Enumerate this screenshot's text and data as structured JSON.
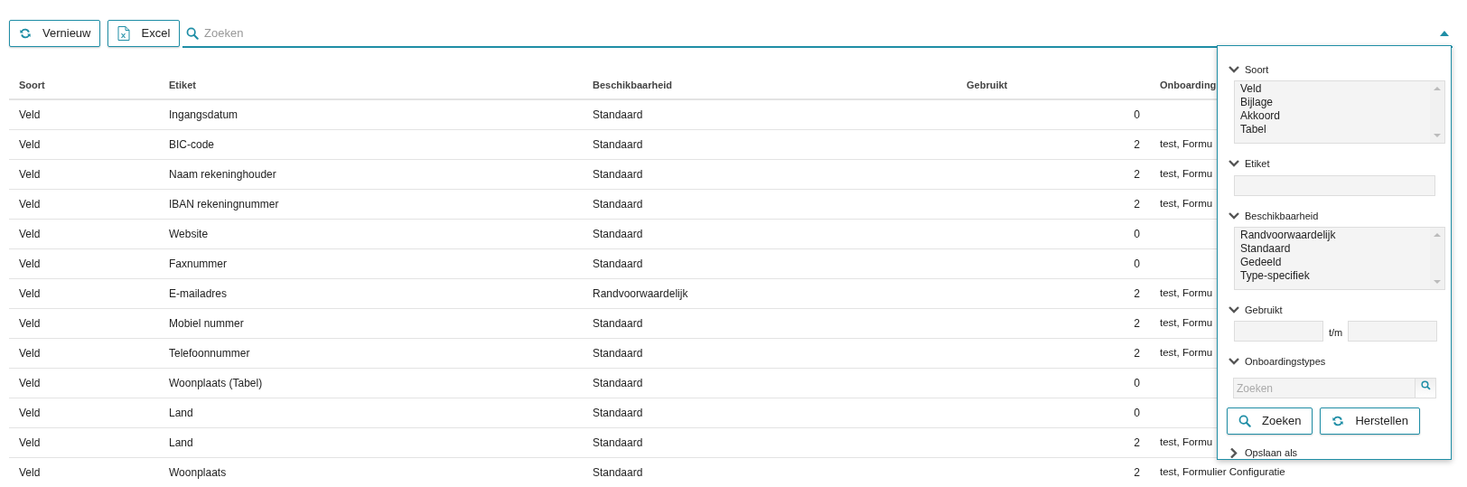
{
  "toolbar": {
    "buttons": [
      {
        "label": "Vernieuw",
        "kind": "refresh"
      },
      {
        "label": "Excel",
        "kind": "excel"
      }
    ],
    "search": {
      "placeholder": "Zoeken"
    },
    "filter_expanded": true
  },
  "table": {
    "columns": [
      "Soort",
      "Etiket",
      "Beschikbaarheid",
      "Gebruikt",
      "Onboarding"
    ],
    "rows": [
      [
        "Veld",
        "Ingangsdatum",
        "Standaard",
        "0",
        ""
      ],
      [
        "Veld",
        "BIC-code",
        "Standaard",
        "2",
        "test, Formu"
      ],
      [
        "Veld",
        "Naam rekeninghouder",
        "Standaard",
        "2",
        "test, Formu"
      ],
      [
        "Veld",
        "IBAN rekeningnummer",
        "Standaard",
        "2",
        "test, Formu"
      ],
      [
        "Veld",
        "Website",
        "Standaard",
        "0",
        ""
      ],
      [
        "Veld",
        "Faxnummer",
        "Standaard",
        "0",
        ""
      ],
      [
        "Veld",
        "E-mailadres",
        "Randvoorwaardelijk",
        "2",
        "test, Formu"
      ],
      [
        "Veld",
        "Mobiel nummer",
        "Standaard",
        "2",
        "test, Formu"
      ],
      [
        "Veld",
        "Telefoonnummer",
        "Standaard",
        "2",
        "test, Formu"
      ],
      [
        "Veld",
        "Woonplaats (Tabel)",
        "Standaard",
        "0",
        ""
      ],
      [
        "Veld",
        "Land",
        "Standaard",
        "0",
        ""
      ],
      [
        "Veld",
        "Land",
        "Standaard",
        "2",
        "test, Formu"
      ],
      [
        "Veld",
        "Woonplaats",
        "Standaard",
        "2",
        "test, Formulier Configuratie"
      ]
    ]
  },
  "filter_panel": {
    "sections": [
      {
        "kind": "list",
        "label": "Soort",
        "expanded": true,
        "options": [
          "Veld",
          "Bijlage",
          "Akkoord",
          "Tabel"
        ]
      },
      {
        "kind": "text",
        "label": "Etiket",
        "expanded": true
      },
      {
        "kind": "list",
        "label": "Beschikbaarheid",
        "expanded": true,
        "options": [
          "Randvoorwaardelijk",
          "Standaard",
          "Gedeeld",
          "Type-specifiek"
        ]
      },
      {
        "kind": "range",
        "label": "Gebruikt",
        "expanded": true,
        "separator": "t/m"
      },
      {
        "kind": "search",
        "label": "Onboardingstypes",
        "expanded": true,
        "placeholder": "Zoeken"
      }
    ],
    "buttons": [
      {
        "label": "Zoeken",
        "kind": "search"
      },
      {
        "label": "Herstellen",
        "kind": "refresh"
      }
    ],
    "save": {
      "label": "Opslaan als",
      "expanded": false
    }
  }
}
